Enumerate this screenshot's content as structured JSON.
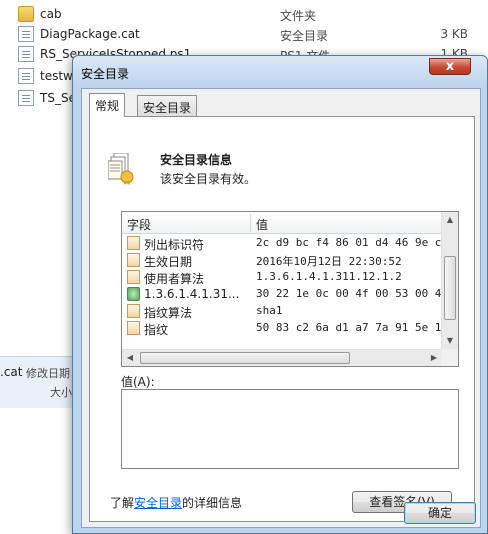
{
  "explorer": {
    "files": [
      {
        "name": "cab",
        "type": "文件夹",
        "size": "",
        "icon": "folder-icon"
      },
      {
        "name": "DiagPackage.cat",
        "type": "安全目录",
        "size": "3 KB",
        "icon": "security-catalog-icon"
      },
      {
        "name": "RS_ServiceIsStopped.ps1",
        "type": "PS1 文件",
        "size": "1 KB",
        "icon": "script-file-icon"
      },
      {
        "name": "testw",
        "type": "",
        "size": "",
        "icon": "file-icon"
      },
      {
        "name": "TS_Se",
        "type": "",
        "size": "",
        "icon": "script-file-icon"
      }
    ],
    "details": {
      "ext": ".cat",
      "modified_label": "修改日期",
      "size_label": "大小"
    }
  },
  "dialog": {
    "title": "安全目录",
    "close_glyph": "x",
    "tabs": [
      {
        "label": "常规",
        "active": true
      },
      {
        "label": "安全目录",
        "active": false
      }
    ],
    "info_title": "安全目录信息",
    "info_desc": "该安全目录有效。",
    "list": {
      "columns": [
        "字段",
        "值"
      ],
      "rows": [
        {
          "field": "列出标识符",
          "value": "2c d9 bc f4 86 01 d4 46 9e c...",
          "icon": "field-icon"
        },
        {
          "field": "生效日期",
          "value": "2016年10月12日 22:30:52",
          "icon": "field-icon"
        },
        {
          "field": "使用者算法",
          "value": "1.3.6.1.4.1.311.12.1.2",
          "icon": "field-icon"
        },
        {
          "field": "1.3.6.1.4.1.31...",
          "value": "30 22 1e 0c 00 4f 00 53 00 4...",
          "icon": "extension-icon"
        },
        {
          "field": "指纹算法",
          "value": "sha1",
          "icon": "field-icon"
        },
        {
          "field": "指纹",
          "value": "50 83 c2 6a d1 a7 7a 91 5e 1...",
          "icon": "field-icon"
        }
      ]
    },
    "value_label": "值(A):",
    "learn_prefix": "了解",
    "learn_link": "安全目录",
    "learn_suffix": "的详细信息",
    "view_signature": "查看签名(V)",
    "ok": "确定"
  },
  "colors": {
    "title_bg": "#bcd3ec",
    "close_red": "#c74a33",
    "link": "#0066cc"
  }
}
